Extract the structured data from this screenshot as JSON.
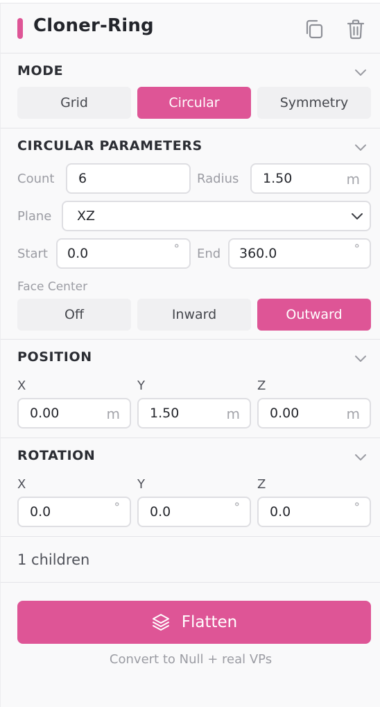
{
  "header": {
    "title": "Cloner-Ring",
    "accent_color": "#de5596",
    "icons": [
      "copy-icon",
      "trash-icon"
    ]
  },
  "mode": {
    "title": "MODE",
    "options": [
      "Grid",
      "Circular",
      "Symmetry"
    ],
    "selected": "Circular"
  },
  "circular": {
    "title": "CIRCULAR PARAMETERS",
    "count_label": "Count",
    "count_value": "6",
    "radius_label": "Radius",
    "radius_value": "1.50",
    "radius_unit": "m",
    "plane_label": "Plane",
    "plane_value": "XZ",
    "start_label": "Start",
    "start_value": "0.0",
    "end_label": "End",
    "end_value": "360.0",
    "deg_unit": "°",
    "face_center_label": "Face Center",
    "face_center_options": [
      "Off",
      "Inward",
      "Outward"
    ],
    "face_center_selected": "Outward"
  },
  "position": {
    "title": "POSITION",
    "x_label": "X",
    "x_value": "0.00",
    "y_label": "Y",
    "y_value": "1.50",
    "z_label": "Z",
    "z_value": "0.00",
    "unit": "m"
  },
  "rotation": {
    "title": "ROTATION",
    "x_label": "X",
    "x_value": "0.0",
    "y_label": "Y",
    "y_value": "0.0",
    "z_label": "Z",
    "z_value": "0.0",
    "unit": "°"
  },
  "footer": {
    "children_text": "1 children",
    "flatten_label": "Flatten",
    "flatten_hint": "Convert to Null + real VPs"
  }
}
